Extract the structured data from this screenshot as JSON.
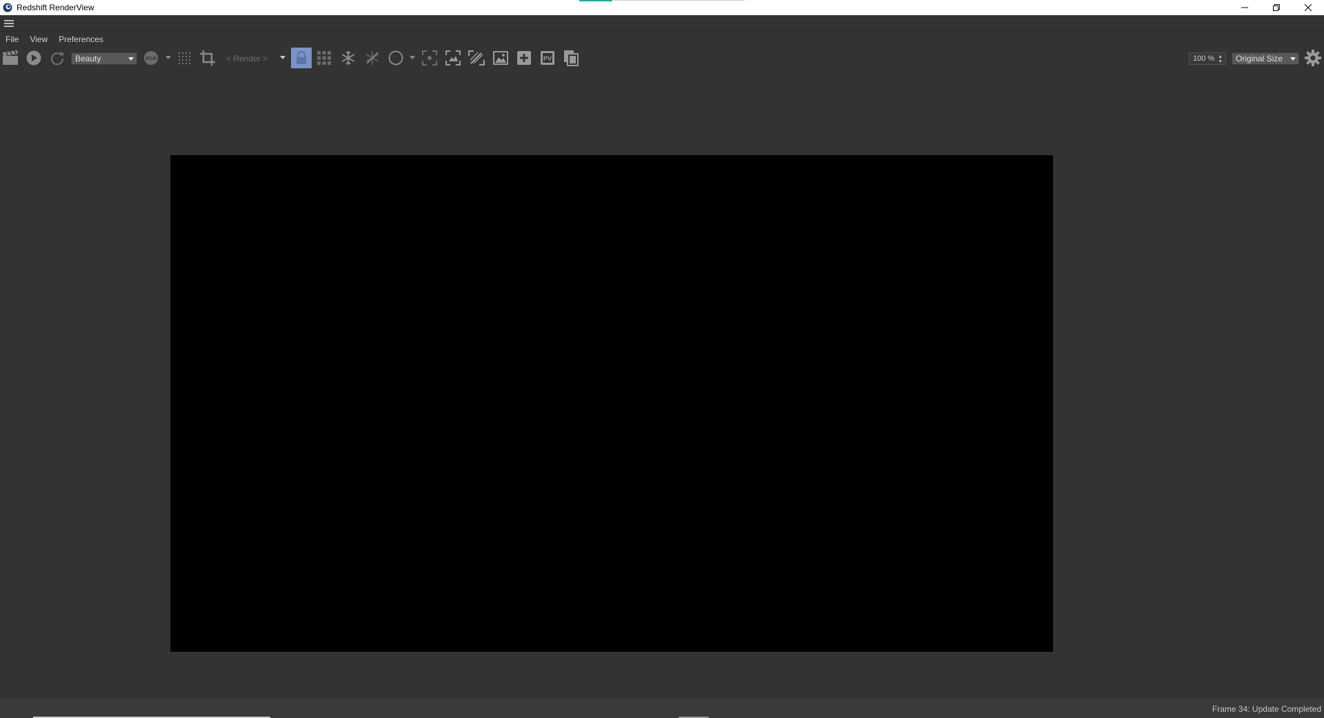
{
  "window": {
    "title": "Redshift RenderView",
    "controls": [
      "minimize-icon",
      "restore-icon",
      "close-icon"
    ]
  },
  "menu": {
    "items": [
      "File",
      "View",
      "Preferences"
    ]
  },
  "toolbar": {
    "aov_select": "Beauty",
    "render_field": "< Render >",
    "rgb_label": "RGB",
    "pv_label": "PV",
    "zoom_value": "100 %",
    "size_select": "Original Size",
    "icons": [
      "clapper-icon",
      "play-icon",
      "refresh-icon",
      "rgb-channel-icon",
      "grid-icon",
      "crop-icon",
      "lock-icon",
      "bucket-grid-icon",
      "snowflake-icon",
      "snowflake-off-icon",
      "circle-icon",
      "focus-frame-icon",
      "fit-frame-icon",
      "magic-icon",
      "image-icon",
      "add-snapshot-icon",
      "pv-icon",
      "copy-icon",
      "settings-gear-icon"
    ]
  },
  "status": {
    "text": "Frame 34: Update Completed"
  },
  "colors": {
    "background": "#333333",
    "viewport": "#000000",
    "active_lock": "#7b93c8",
    "accent": "#26a69a"
  }
}
